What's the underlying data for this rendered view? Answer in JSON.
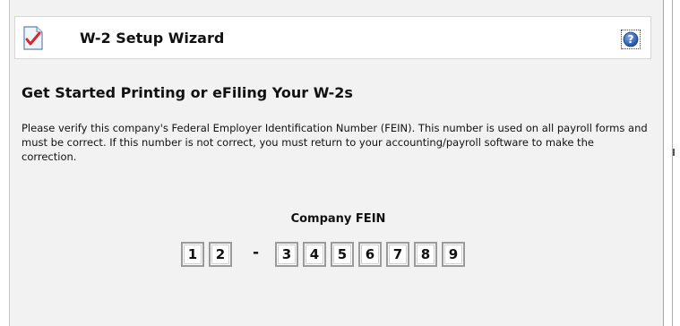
{
  "wizard": {
    "title": "W-2 Setup Wizard",
    "help_icon": "help-question-icon",
    "doc_icon": "checklist-document-icon"
  },
  "page": {
    "heading": "Get Started Printing or eFiling Your W-2s",
    "description": "Please verify this company's Federal Employer Identification Number (FEIN). This number is used on all payroll forms and must be correct. If this number is not correct, you must return to your accounting/payroll software to make the correction."
  },
  "fein": {
    "label": "Company FEIN",
    "separator": "-",
    "digits": [
      "1",
      "2",
      "3",
      "4",
      "5",
      "6",
      "7",
      "8",
      "9"
    ]
  },
  "colors": {
    "dialog_bg": "#f2f2f2",
    "header_bg": "#ffffff",
    "check_red": "#d9262a",
    "help_blue": "#2a5db0"
  }
}
